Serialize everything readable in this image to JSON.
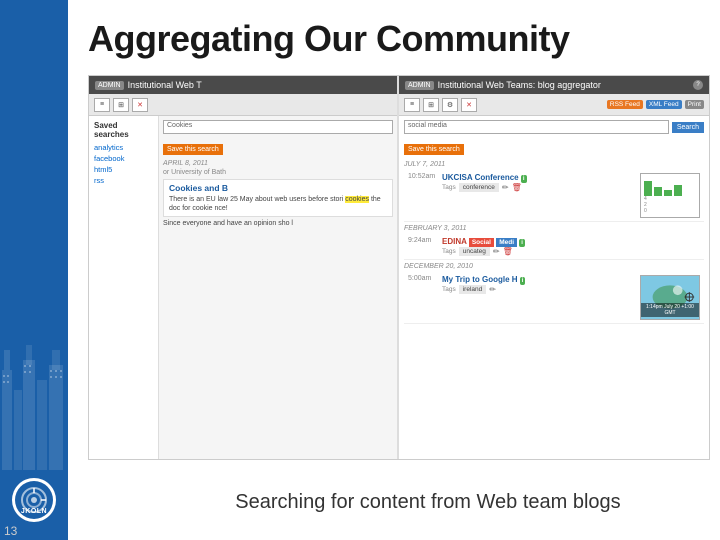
{
  "title": "Aggregating Our Community",
  "caption": "Searching for content from Web team blogs",
  "page_number": "13",
  "left_panel": {
    "header": "Institutional Web T",
    "admin_label": "ADMIN",
    "sidebar": {
      "label": "Saved searches",
      "items": [
        "analytics",
        "facebook",
        "html5",
        "rss"
      ]
    },
    "search_placeholder": "Cookies",
    "save_search_btn": "Save this search",
    "date1": "APRIL 8, 2011",
    "sub_label": "or University of Bath",
    "blog_title": "Cookies and B",
    "blog_text": "There is an EU law 25 May about web users before stori",
    "highlight_word": "cookies",
    "more_text": "the doc for cookie nce!"
  },
  "right_panel": {
    "header": "Institutional Web Teams: blog aggregator",
    "admin_label": "ADMIN",
    "search_placeholder": "social media",
    "search_btn": "Search",
    "save_search_btn": "Save this search",
    "feed_btn": "RSS Feed",
    "xml_btn": "XML Feed",
    "print_btn": "Print",
    "entries": [
      {
        "date": "JULY 7, 2011",
        "time": "10:52am",
        "title": "UKCISA Conference",
        "tags_label": "Tags",
        "tag": "conference"
      },
      {
        "date": "FEBRUARY 3, 2011",
        "time": "9:24am",
        "title": "EDINA Social Media",
        "tags_label": "Tags",
        "tag": "uncateg"
      },
      {
        "date": "DECEMBER 20, 2010",
        "time": "5:00am",
        "title": "My Trip to Google H",
        "tags_label": "Tags",
        "tag": "ireland"
      }
    ]
  },
  "logo": {
    "text": "JKOLN"
  }
}
